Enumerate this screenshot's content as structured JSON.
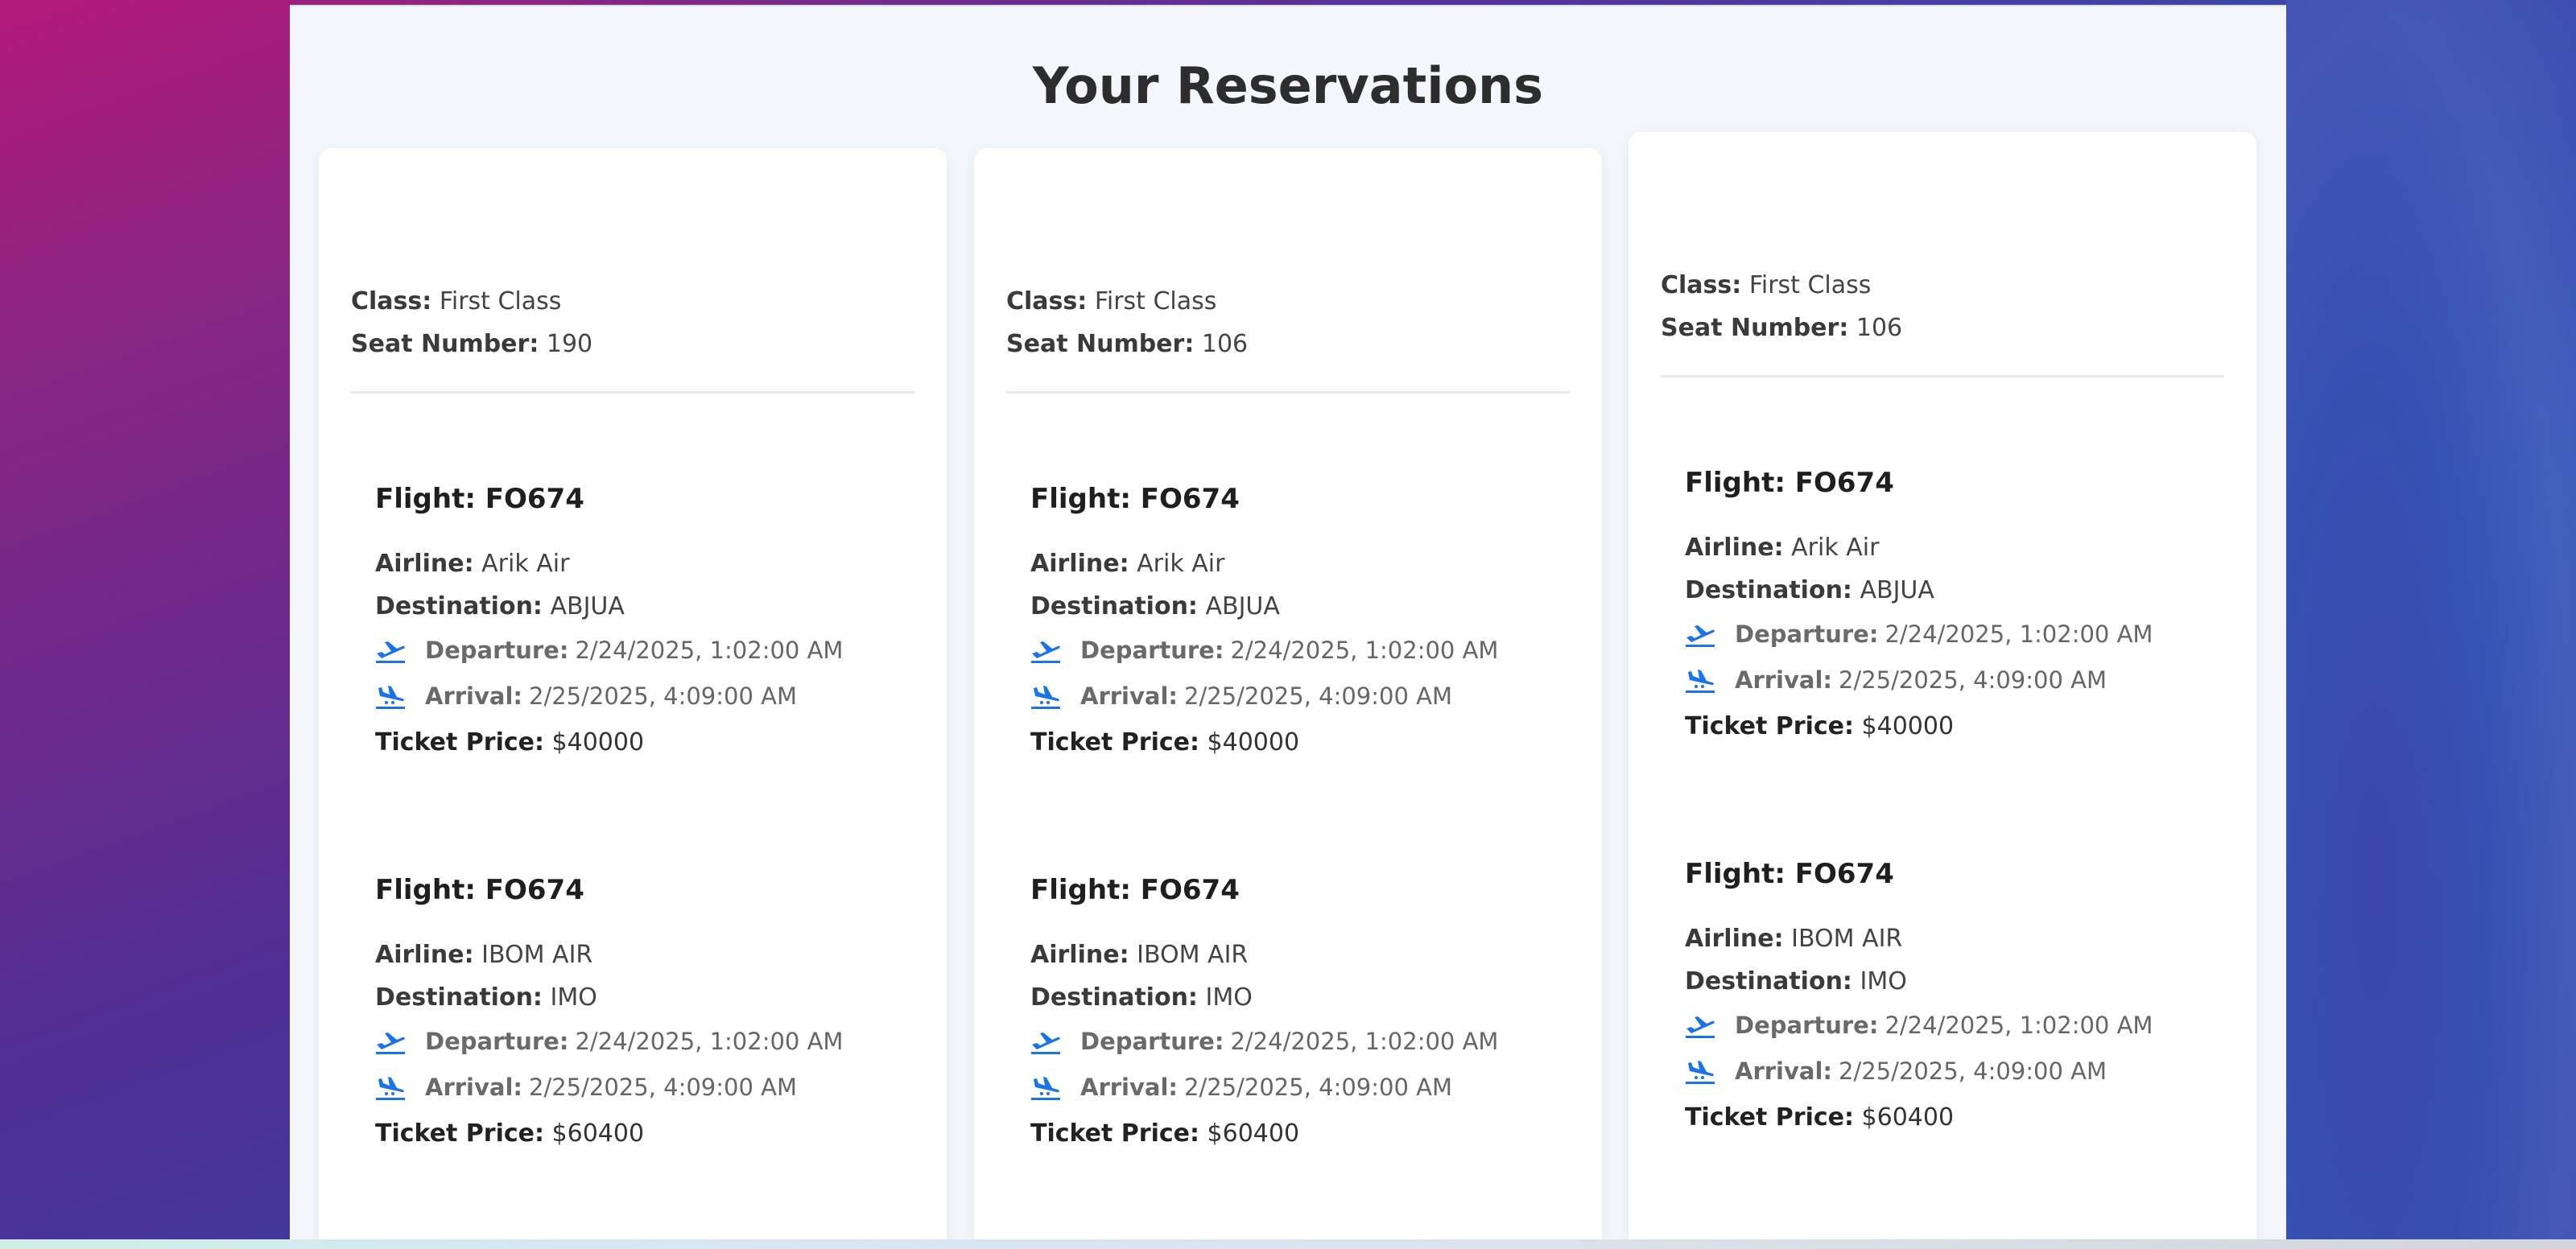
{
  "page": {
    "title": "Your Reservations"
  },
  "labels": {
    "class": "Class:",
    "seat": "Seat Number:",
    "airline": "Airline:",
    "destination": "Destination:",
    "departure": "Departure:",
    "arrival": "Arrival:",
    "price": "Ticket Price:"
  },
  "colors": {
    "accent": "#1a73e8",
    "panel": "#f3f6fb"
  },
  "icons": {
    "departure": "plane-departure-icon",
    "arrival": "plane-arrival-icon"
  },
  "reservations": [
    {
      "class": "First Class",
      "seat": "190",
      "flights": [
        {
          "title": "Flight: FO674",
          "airline": "Arik Air",
          "destination": "ABJUA",
          "departure": "2/24/2025, 1:02:00 AM",
          "arrival": "2/25/2025, 4:09:00 AM",
          "price": "$40000"
        },
        {
          "title": "Flight: FO674",
          "airline": "IBOM AIR",
          "destination": "IMO",
          "departure": "2/24/2025, 1:02:00 AM",
          "arrival": "2/25/2025, 4:09:00 AM",
          "price": "$60400"
        }
      ]
    },
    {
      "class": "First Class",
      "seat": "106",
      "flights": [
        {
          "title": "Flight: FO674",
          "airline": "Arik Air",
          "destination": "ABJUA",
          "departure": "2/24/2025, 1:02:00 AM",
          "arrival": "2/25/2025, 4:09:00 AM",
          "price": "$40000"
        },
        {
          "title": "Flight: FO674",
          "airline": "IBOM AIR",
          "destination": "IMO",
          "departure": "2/24/2025, 1:02:00 AM",
          "arrival": "2/25/2025, 4:09:00 AM",
          "price": "$60400"
        }
      ]
    },
    {
      "class": "First Class",
      "seat": "106",
      "flights": [
        {
          "title": "Flight: FO674",
          "airline": "Arik Air",
          "destination": "ABJUA",
          "departure": "2/24/2025, 1:02:00 AM",
          "arrival": "2/25/2025, 4:09:00 AM",
          "price": "$40000"
        },
        {
          "title": "Flight: FO674",
          "airline": "IBOM AIR",
          "destination": "IMO",
          "departure": "2/24/2025, 1:02:00 AM",
          "arrival": "2/25/2025, 4:09:00 AM",
          "price": "$60400"
        }
      ]
    }
  ]
}
